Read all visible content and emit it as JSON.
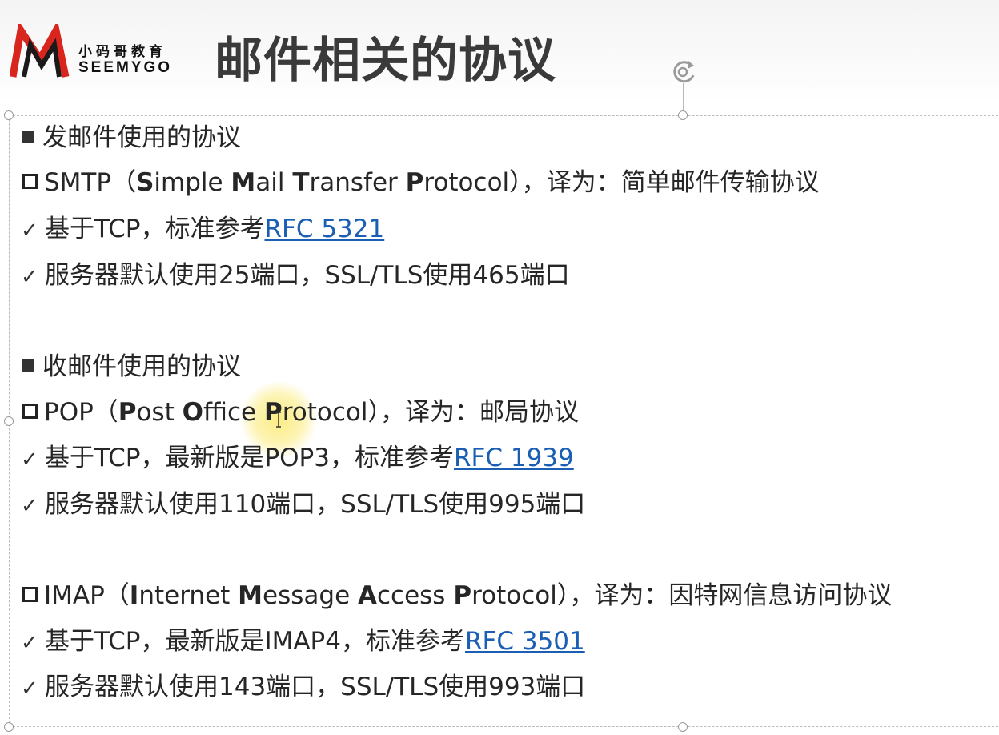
{
  "logo": {
    "cn": "小码哥教育",
    "en": "SEEMYGO"
  },
  "title": "邮件相关的协议",
  "colors": {
    "link": "#1a5fb4",
    "title": "#3a3a3a",
    "logo_red": "#d8261f",
    "highlight": "#f5e15a"
  },
  "sections": {
    "send_heading": "发邮件使用的协议",
    "smtp": {
      "name": "SMTP",
      "open": "（",
      "w1_bold": "S",
      "w1_rest": "imple ",
      "w2_bold": "M",
      "w2_rest": "ail ",
      "w3_bold": "T",
      "w3_rest": "ransfer ",
      "w4_bold": "P",
      "w4_rest": "rotocol",
      "close": "），译为：简单邮件传输协议",
      "line1_prefix": "基于TCP，标准参考",
      "line1_link": "RFC 5321",
      "line2": "服务器默认使用25端口，SSL/TLS使用465端口"
    },
    "receive_heading": "收邮件使用的协议",
    "pop": {
      "name": "POP",
      "open": "（",
      "w1_bold": "P",
      "w1_rest": "ost ",
      "w2_bold": "O",
      "w2_rest": "ffice ",
      "w3_bold": "P",
      "w3_rest": "rotocol",
      "close": "），译为：邮局协议",
      "line1_prefix": "基于TCP，最新版是POP3，标准参考",
      "line1_link": "RFC 1939",
      "line2": "服务器默认使用110端口，SSL/TLS使用995端口"
    },
    "imap": {
      "name": "IMAP",
      "open": "（",
      "w1_bold": "I",
      "w1_rest": "nternet ",
      "w2_bold": "M",
      "w2_rest": "essage ",
      "w3_bold": "A",
      "w3_rest": "ccess ",
      "w4_bold": "P",
      "w4_rest": "rotocol",
      "close": "），译为：因特网信息访问协议",
      "line1_prefix": "基于TCP，最新版是IMAP4，标准参考",
      "line1_link": "RFC 3501",
      "line2": "服务器默认使用143端口，SSL/TLS使用993端口"
    }
  }
}
